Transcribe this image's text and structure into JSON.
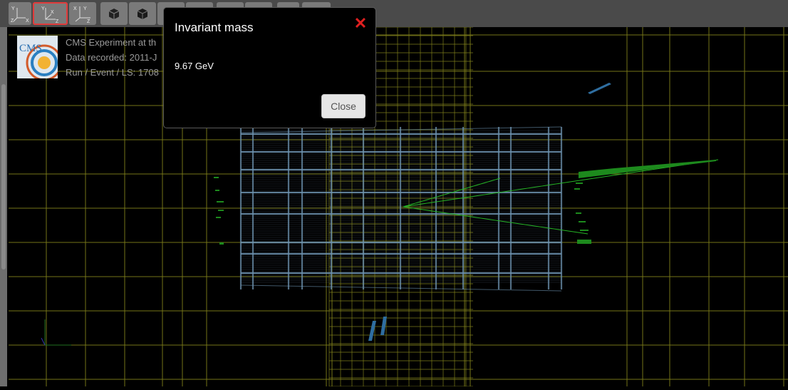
{
  "toolbar": {
    "view_buttons": [
      {
        "name": "view-yz-button",
        "label_x": "Y",
        "label_y": "Z",
        "label_z": "X"
      },
      {
        "name": "view-xz-button",
        "label_x": "Y",
        "label_y": "X",
        "label_z": "Z",
        "selected": true
      },
      {
        "name": "view-xy-button",
        "label_x": "X",
        "label_y": "Y",
        "label_z": "Z"
      }
    ],
    "projection_buttons": [
      "perspective-view-button",
      "orthographic-view-button"
    ]
  },
  "event_info": {
    "line1": "CMS Experiment at th",
    "line2": "Data recorded: 2011-J",
    "line3": "Run / Event / LS: 1708"
  },
  "logo": {
    "text": "CMS"
  },
  "modal": {
    "title": "Invariant mass",
    "value": "9.67 GeV",
    "close_icon": "close-icon",
    "close_label": "Close"
  },
  "colors": {
    "grid": "#7c7c1a",
    "detector": "#6d93b0",
    "tracks": "#26b526",
    "accent_red": "#e02020"
  }
}
